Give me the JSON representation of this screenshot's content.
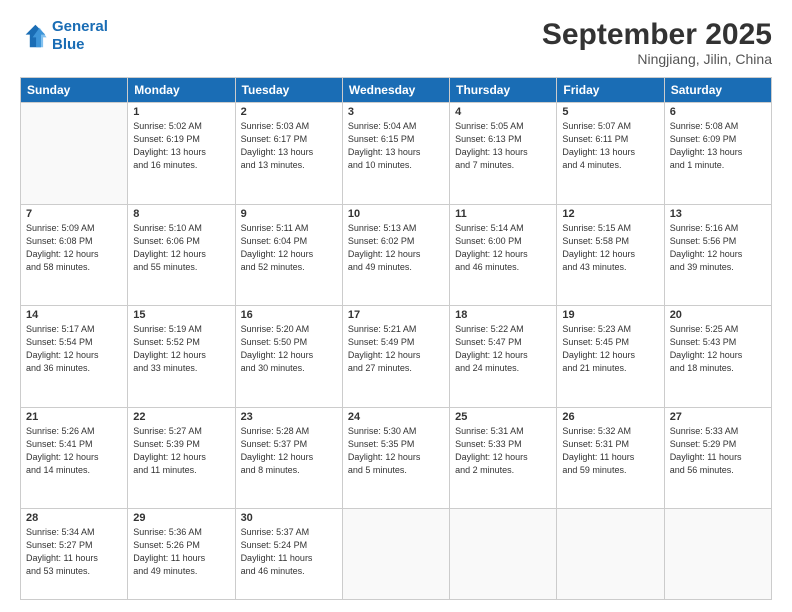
{
  "header": {
    "logo_line1": "General",
    "logo_line2": "Blue",
    "month": "September 2025",
    "location": "Ningjiang, Jilin, China"
  },
  "weekdays": [
    "Sunday",
    "Monday",
    "Tuesday",
    "Wednesday",
    "Thursday",
    "Friday",
    "Saturday"
  ],
  "weeks": [
    [
      {
        "day": "",
        "info": ""
      },
      {
        "day": "1",
        "info": "Sunrise: 5:02 AM\nSunset: 6:19 PM\nDaylight: 13 hours\nand 16 minutes."
      },
      {
        "day": "2",
        "info": "Sunrise: 5:03 AM\nSunset: 6:17 PM\nDaylight: 13 hours\nand 13 minutes."
      },
      {
        "day": "3",
        "info": "Sunrise: 5:04 AM\nSunset: 6:15 PM\nDaylight: 13 hours\nand 10 minutes."
      },
      {
        "day": "4",
        "info": "Sunrise: 5:05 AM\nSunset: 6:13 PM\nDaylight: 13 hours\nand 7 minutes."
      },
      {
        "day": "5",
        "info": "Sunrise: 5:07 AM\nSunset: 6:11 PM\nDaylight: 13 hours\nand 4 minutes."
      },
      {
        "day": "6",
        "info": "Sunrise: 5:08 AM\nSunset: 6:09 PM\nDaylight: 13 hours\nand 1 minute."
      }
    ],
    [
      {
        "day": "7",
        "info": "Sunrise: 5:09 AM\nSunset: 6:08 PM\nDaylight: 12 hours\nand 58 minutes."
      },
      {
        "day": "8",
        "info": "Sunrise: 5:10 AM\nSunset: 6:06 PM\nDaylight: 12 hours\nand 55 minutes."
      },
      {
        "day": "9",
        "info": "Sunrise: 5:11 AM\nSunset: 6:04 PM\nDaylight: 12 hours\nand 52 minutes."
      },
      {
        "day": "10",
        "info": "Sunrise: 5:13 AM\nSunset: 6:02 PM\nDaylight: 12 hours\nand 49 minutes."
      },
      {
        "day": "11",
        "info": "Sunrise: 5:14 AM\nSunset: 6:00 PM\nDaylight: 12 hours\nand 46 minutes."
      },
      {
        "day": "12",
        "info": "Sunrise: 5:15 AM\nSunset: 5:58 PM\nDaylight: 12 hours\nand 43 minutes."
      },
      {
        "day": "13",
        "info": "Sunrise: 5:16 AM\nSunset: 5:56 PM\nDaylight: 12 hours\nand 39 minutes."
      }
    ],
    [
      {
        "day": "14",
        "info": "Sunrise: 5:17 AM\nSunset: 5:54 PM\nDaylight: 12 hours\nand 36 minutes."
      },
      {
        "day": "15",
        "info": "Sunrise: 5:19 AM\nSunset: 5:52 PM\nDaylight: 12 hours\nand 33 minutes."
      },
      {
        "day": "16",
        "info": "Sunrise: 5:20 AM\nSunset: 5:50 PM\nDaylight: 12 hours\nand 30 minutes."
      },
      {
        "day": "17",
        "info": "Sunrise: 5:21 AM\nSunset: 5:49 PM\nDaylight: 12 hours\nand 27 minutes."
      },
      {
        "day": "18",
        "info": "Sunrise: 5:22 AM\nSunset: 5:47 PM\nDaylight: 12 hours\nand 24 minutes."
      },
      {
        "day": "19",
        "info": "Sunrise: 5:23 AM\nSunset: 5:45 PM\nDaylight: 12 hours\nand 21 minutes."
      },
      {
        "day": "20",
        "info": "Sunrise: 5:25 AM\nSunset: 5:43 PM\nDaylight: 12 hours\nand 18 minutes."
      }
    ],
    [
      {
        "day": "21",
        "info": "Sunrise: 5:26 AM\nSunset: 5:41 PM\nDaylight: 12 hours\nand 14 minutes."
      },
      {
        "day": "22",
        "info": "Sunrise: 5:27 AM\nSunset: 5:39 PM\nDaylight: 12 hours\nand 11 minutes."
      },
      {
        "day": "23",
        "info": "Sunrise: 5:28 AM\nSunset: 5:37 PM\nDaylight: 12 hours\nand 8 minutes."
      },
      {
        "day": "24",
        "info": "Sunrise: 5:30 AM\nSunset: 5:35 PM\nDaylight: 12 hours\nand 5 minutes."
      },
      {
        "day": "25",
        "info": "Sunrise: 5:31 AM\nSunset: 5:33 PM\nDaylight: 12 hours\nand 2 minutes."
      },
      {
        "day": "26",
        "info": "Sunrise: 5:32 AM\nSunset: 5:31 PM\nDaylight: 11 hours\nand 59 minutes."
      },
      {
        "day": "27",
        "info": "Sunrise: 5:33 AM\nSunset: 5:29 PM\nDaylight: 11 hours\nand 56 minutes."
      }
    ],
    [
      {
        "day": "28",
        "info": "Sunrise: 5:34 AM\nSunset: 5:27 PM\nDaylight: 11 hours\nand 53 minutes."
      },
      {
        "day": "29",
        "info": "Sunrise: 5:36 AM\nSunset: 5:26 PM\nDaylight: 11 hours\nand 49 minutes."
      },
      {
        "day": "30",
        "info": "Sunrise: 5:37 AM\nSunset: 5:24 PM\nDaylight: 11 hours\nand 46 minutes."
      },
      {
        "day": "",
        "info": ""
      },
      {
        "day": "",
        "info": ""
      },
      {
        "day": "",
        "info": ""
      },
      {
        "day": "",
        "info": ""
      }
    ]
  ]
}
